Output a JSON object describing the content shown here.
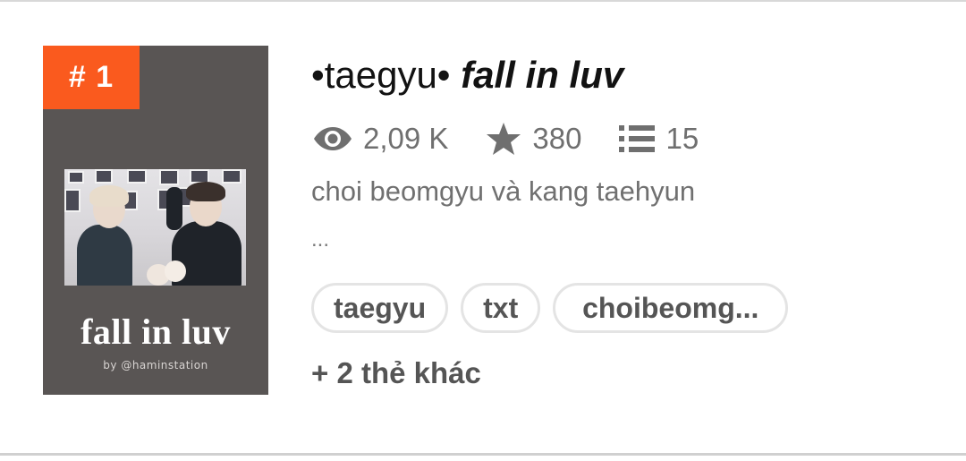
{
  "story": {
    "rank": "# 1",
    "title_prefix": "•taegyu• ",
    "title_main": "fall in luv",
    "cover": {
      "title": "fall in luv",
      "author": "by @haminstation",
      "background_color": "#595554"
    },
    "stats": {
      "reads": "2,09 K",
      "votes": "380",
      "parts": "15"
    },
    "description": "choi beomgyu và kang taehyun",
    "ellipsis": "...",
    "tags": [
      "taegyu",
      "txt",
      "choibeomg..."
    ],
    "more_tags": "+ 2 thẻ khác"
  },
  "colors": {
    "rank_badge": "#fa5a1e",
    "title_text": "#121212",
    "meta_text": "#6f6f6f",
    "tag_border": "#e4e4e4"
  },
  "icons": {
    "reads": "eye-icon",
    "votes": "star-icon",
    "parts": "list-icon"
  }
}
